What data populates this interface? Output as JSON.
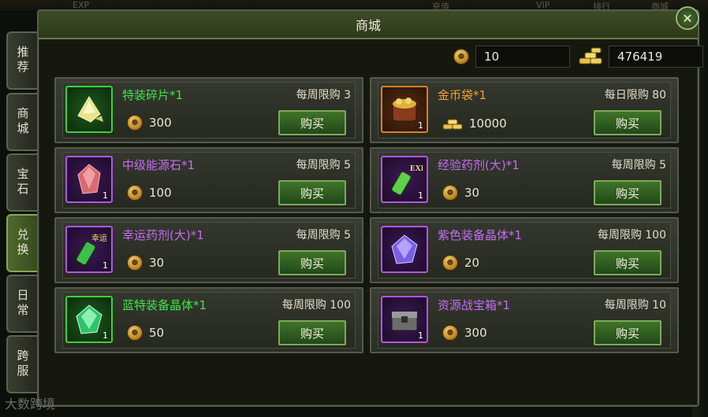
{
  "shop": {
    "title": "商城",
    "close_symbol": "✕"
  },
  "side_tabs": [
    {
      "label": "推荐",
      "active": false
    },
    {
      "label": "商城",
      "active": false
    },
    {
      "label": "宝石",
      "active": false
    },
    {
      "label": "兑换",
      "active": true
    },
    {
      "label": "日常",
      "active": false
    },
    {
      "label": "跨服",
      "active": false
    }
  ],
  "currency": {
    "coins": "10",
    "gold": "476419"
  },
  "items": [
    {
      "name": "特装碎片*1",
      "quality": "green",
      "limit": "每周限购 3",
      "price": "300",
      "price_currency": "coin",
      "count": "",
      "icon": "crystal-shards-icon",
      "buy_label": "购买"
    },
    {
      "name": "金币袋*1",
      "quality": "orange",
      "limit": "每日限购 80",
      "price": "10000",
      "price_currency": "gold",
      "count": "1",
      "icon": "coin-bag-icon",
      "buy_label": "购买"
    },
    {
      "name": "中级能源石*1",
      "quality": "purple",
      "limit": "每周限购 5",
      "price": "100",
      "price_currency": "coin",
      "count": "1",
      "icon": "energy-stone-icon",
      "buy_label": "购买"
    },
    {
      "name": "经验药剂(大)*1",
      "quality": "purple",
      "limit": "每周限购 5",
      "price": "30",
      "price_currency": "coin",
      "count": "1",
      "icon": "exp-potion-icon",
      "buy_label": "购买",
      "badge": "EXP"
    },
    {
      "name": "幸运药剂(大)*1",
      "quality": "purple",
      "limit": "每周限购 5",
      "price": "30",
      "price_currency": "coin",
      "count": "1",
      "icon": "luck-potion-icon",
      "buy_label": "购买",
      "badge": "幸运"
    },
    {
      "name": "紫色装备晶体*1",
      "quality": "purple",
      "limit": "每周限购 100",
      "price": "20",
      "price_currency": "coin",
      "count": "",
      "icon": "purple-crystal-icon",
      "buy_label": "购买"
    },
    {
      "name": "蓝特装备晶体*1",
      "quality": "green",
      "limit": "每周限购 100",
      "price": "50",
      "price_currency": "coin",
      "count": "1",
      "icon": "green-crystal-icon",
      "buy_label": "购买"
    },
    {
      "name": "资源战宝箱*1",
      "quality": "purple",
      "limit": "每周限购 10",
      "price": "300",
      "price_currency": "coin",
      "count": "1",
      "icon": "resource-chest-icon",
      "buy_label": "购买"
    }
  ],
  "background_hints": [
    "EXP",
    "充值",
    "VIP",
    "排行",
    "商城"
  ],
  "watermark": "大数跨境"
}
